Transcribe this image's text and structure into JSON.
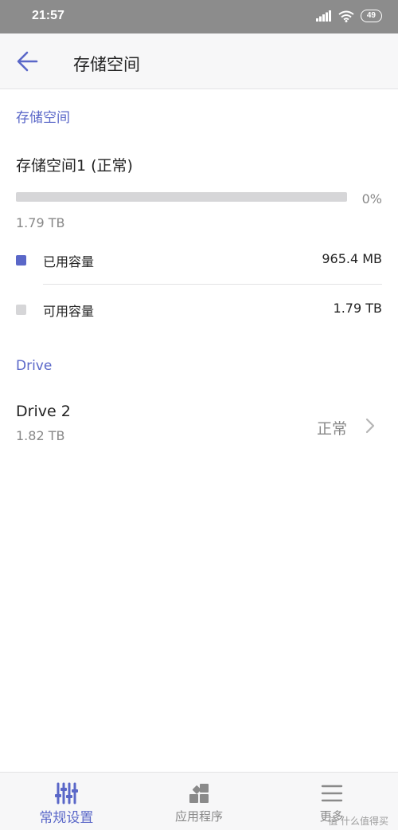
{
  "status_bar": {
    "time": "21:57",
    "battery": "49"
  },
  "app_bar": {
    "title": "存储空间"
  },
  "storage_section": {
    "header": "存储空间",
    "pool_name": "存储空间1 (正常)",
    "usage_percent": 0,
    "usage_percent_label": "0%",
    "total_size": "1.79 TB",
    "used": {
      "label": "已用容量",
      "value": "965.4 MB",
      "color": "#5a67c8"
    },
    "available": {
      "label": "可用容量",
      "value": "1.79 TB",
      "color": "#d6d6d8"
    }
  },
  "drive_section": {
    "header": "Drive",
    "drives": [
      {
        "name": "Drive 2",
        "size": "1.82 TB",
        "status": "正常"
      }
    ]
  },
  "bottom_nav": {
    "items": [
      {
        "label": "常规设置",
        "icon": "sliders-icon",
        "active": true
      },
      {
        "label": "应用程序",
        "icon": "apps-grid-icon",
        "active": false
      },
      {
        "label": "更多",
        "icon": "menu-icon",
        "active": false
      }
    ]
  },
  "watermark": "什么值得买",
  "colors": {
    "accent": "#5a67c8",
    "status_bar": "#8c8c8c"
  }
}
